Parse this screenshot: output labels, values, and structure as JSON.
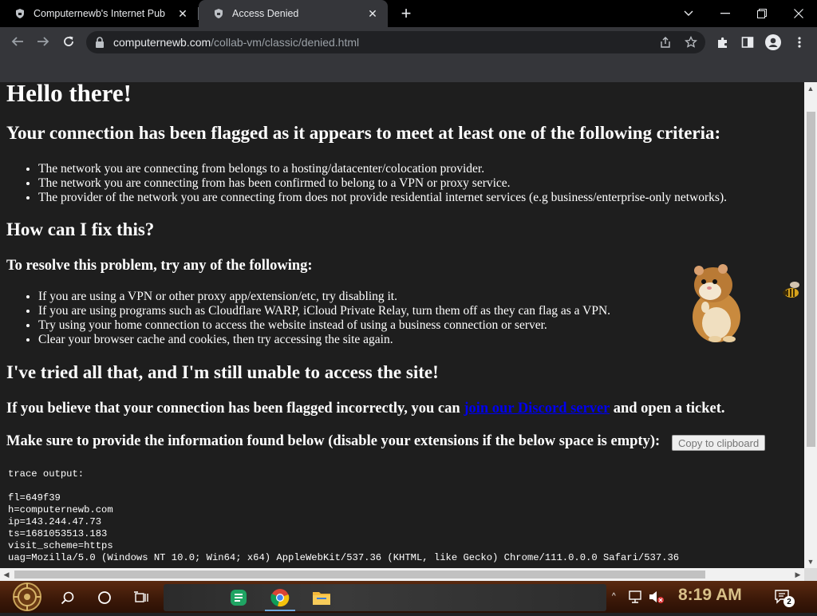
{
  "browser": {
    "tabs": [
      {
        "label": "Computernewb's Internet Pub",
        "active": false
      },
      {
        "label": "Access Denied",
        "active": true
      }
    ],
    "url_host": "computernewb.com",
    "url_path": "/collab-vm/classic/denied.html"
  },
  "page": {
    "heading": "Hello there!",
    "flag_heading": "Your connection has been flagged as it appears to meet at least one of the following criteria:",
    "criteria": [
      "The network you are connecting from belongs to a hosting/datacenter/colocation provider.",
      "The network you are connecting from has been confirmed to belong to a VPN or proxy service.",
      "The provider of the network you are connecting from does not provide residential internet services (e.g business/enterprise-only networks)."
    ],
    "fix_heading": "How can I fix this?",
    "resolve_heading": "To resolve this problem, try any of the following:",
    "fixes": [
      "If you are using a VPN or other proxy app/extension/etc, try disabling it.",
      "If you are using programs such as Cloudflare WARP, iCloud Private Relay, turn them off as they can flag as a VPN.",
      "Try using your home connection to access the website instead of using a business connection or server.",
      "Clear your browser cache and cookies, then try accessing the site again."
    ],
    "tried_heading": "I've tried all that, and I'm still unable to access the site!",
    "incorrect_prefix": "If you believe that your connection has been flagged incorrectly, you can",
    "discord_link": "join our Discord server",
    "incorrect_suffix": "and open a ticket.",
    "info_text": "Make sure to provide the information found below (disable your extensions if the below space is empty):",
    "copy_button": "Copy to clipboard",
    "trace_lines": [
      "trace output:",
      "",
      "fl=649f39",
      "h=computernewb.com",
      "ip=143.244.47.73",
      "ts=1681053513.183",
      "visit_scheme=https",
      "uag=Mozilla/5.0 (Windows NT 10.0; Win64; x64) AppleWebKit/537.36 (KHTML, like Gecko) Chrome/111.0.0.0 Safari/537.36"
    ]
  },
  "taskbar": {
    "clock": "8:19 AM",
    "notification_count": "2"
  },
  "colors": {
    "link": "#0000ee",
    "page_bg": "#1e1e1e",
    "clock": "#d8c089"
  }
}
